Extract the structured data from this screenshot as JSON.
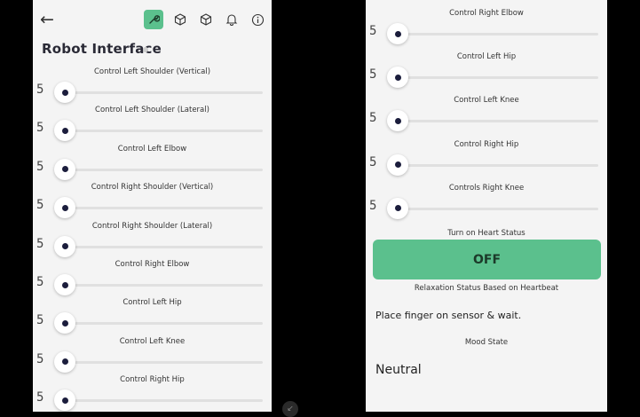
{
  "left": {
    "back_icon": "arrow-left-icon",
    "toolbar_icons": [
      "wrench-icon",
      "cube-outline-icon",
      "cube-filled-icon",
      "bell-icon",
      "info-icon"
    ],
    "title": "Robot Interface",
    "sliders": [
      {
        "label": "Control Left Shoulder (Vertical)",
        "value": "5"
      },
      {
        "label": "Control Left Shoulder (Lateral)",
        "value": "5"
      },
      {
        "label": "Control Left Elbow",
        "value": "5"
      },
      {
        "label": "Control Right Shoulder (Vertical)",
        "value": "5"
      },
      {
        "label": "Control Right Shoulder (Lateral)",
        "value": "5"
      },
      {
        "label": "Control Right Elbow",
        "value": "5"
      },
      {
        "label": "Control Left Hip",
        "value": "5"
      },
      {
        "label": "Control Left Knee",
        "value": "5"
      },
      {
        "label": "Control Right Hip",
        "value": "5"
      }
    ]
  },
  "right": {
    "sliders": [
      {
        "label": "Control Right Elbow",
        "value": "5"
      },
      {
        "label": "Control Left Hip",
        "value": "5"
      },
      {
        "label": "Control Left Knee",
        "value": "5"
      },
      {
        "label": "Control Right Hip",
        "value": "5"
      },
      {
        "label": "Controls Right Knee",
        "value": "5"
      }
    ],
    "heart_status_label": "Turn on Heart Status",
    "heart_button_label": "OFF",
    "relaxation_label": "Relaxation Status Based on Heartbeat",
    "instruction_text": "Place finger on sensor & wait.",
    "mood_label": "Mood State",
    "mood_value": "Neutral"
  },
  "colors": {
    "accent": "#5bc08d",
    "thumb": "#1b1d3c",
    "panel_bg": "#f4f4f4",
    "outer_bg": "#000000"
  }
}
